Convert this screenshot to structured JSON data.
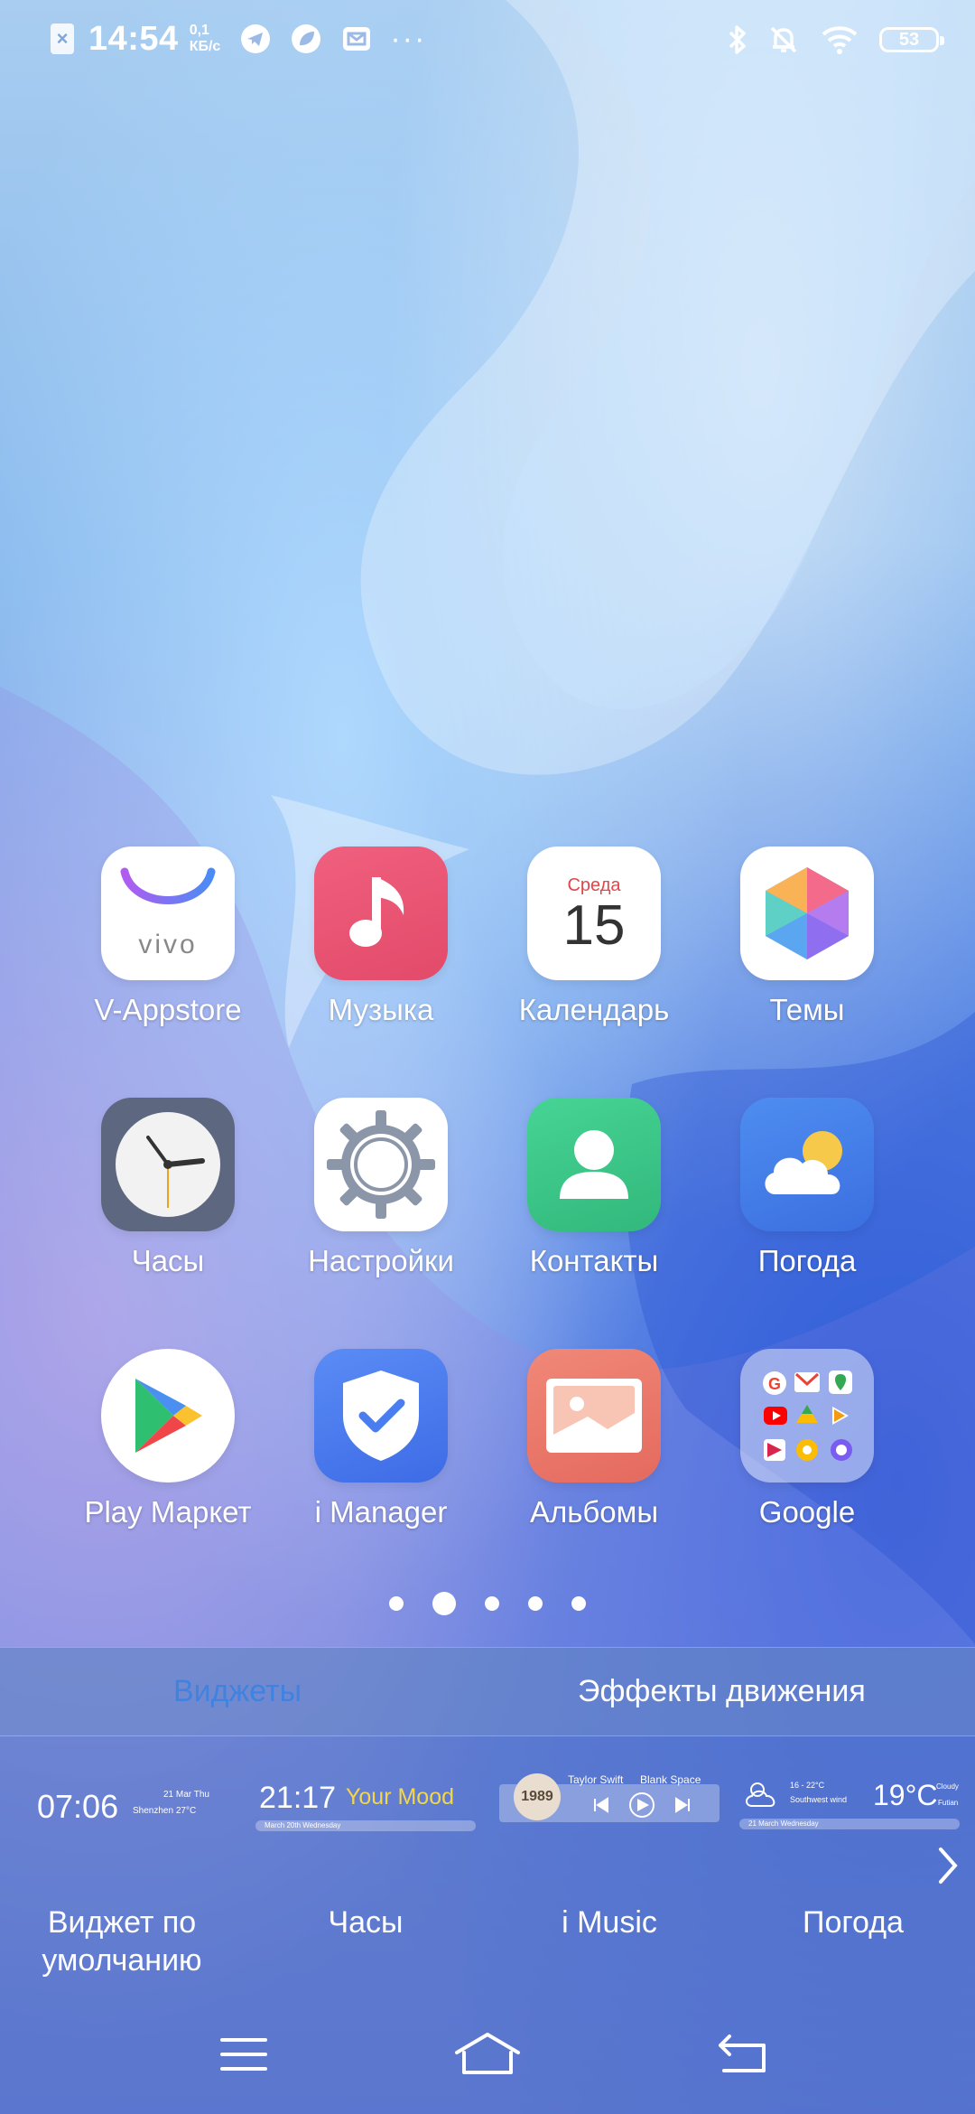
{
  "status_bar": {
    "time": "14:54",
    "speed_value": "0,1",
    "speed_unit": "КБ/с",
    "more": "···",
    "battery": "53",
    "sim_icon": "sim-off-icon",
    "icons_left": [
      "telegram-icon",
      "leaf-app-icon",
      "mail-icon"
    ],
    "icons_right": [
      "bluetooth-icon",
      "bell-muted-icon",
      "wifi-icon",
      "battery-icon"
    ]
  },
  "apps": [
    {
      "label": "V-Appstore",
      "icon": "vivo-appstore-icon"
    },
    {
      "label": "Музыка",
      "icon": "music-icon"
    },
    {
      "label": "Календарь",
      "icon": "calendar-icon",
      "weekday": "Среда",
      "day": "15"
    },
    {
      "label": "Темы",
      "icon": "themes-icon"
    },
    {
      "label": "Часы",
      "icon": "clock-icon"
    },
    {
      "label": "Настройки",
      "icon": "settings-gear-icon"
    },
    {
      "label": "Контакты",
      "icon": "contacts-icon"
    },
    {
      "label": "Погода",
      "icon": "weather-icon"
    },
    {
      "label": "Play Маркет",
      "icon": "play-store-icon"
    },
    {
      "label": "i Manager",
      "icon": "shield-check-icon"
    },
    {
      "label": "Альбомы",
      "icon": "gallery-icon"
    },
    {
      "label": "Google",
      "icon": "google-folder-icon"
    }
  ],
  "pages": {
    "count": 5,
    "active": 2
  },
  "panel": {
    "tabs": [
      {
        "label": "Виджеты",
        "active": true
      },
      {
        "label": "Эффекты движения",
        "active": false
      }
    ],
    "widgets": [
      {
        "name": "Виджет по умолчанию",
        "preview": {
          "time": "07:06",
          "date": "21 Mar Thu",
          "place": "Shenzhen 27°C"
        }
      },
      {
        "name": "Часы",
        "preview": {
          "time": "21:17",
          "mood": "Your Mood",
          "sub": "March 20th Wednesday"
        }
      },
      {
        "name": "i Music",
        "preview": {
          "artist": "Taylor Swift",
          "track": "Blank Space",
          "cover": "1989"
        }
      },
      {
        "name": "Погода",
        "preview": {
          "range": "16 - 22°C",
          "wind": "Southwest wind",
          "temp": "19°C",
          "cond": "Cloudy",
          "city": "Futian",
          "date": "21 March Wednesday"
        }
      }
    ]
  },
  "nav": [
    "menu-icon",
    "home-icon",
    "back-icon"
  ],
  "colors": {
    "accent": "#3f82e0",
    "music": "#e85a78",
    "contacts": "#3ec98a",
    "imanager": "#4a7df0",
    "gallery": "#ea7a6c"
  }
}
